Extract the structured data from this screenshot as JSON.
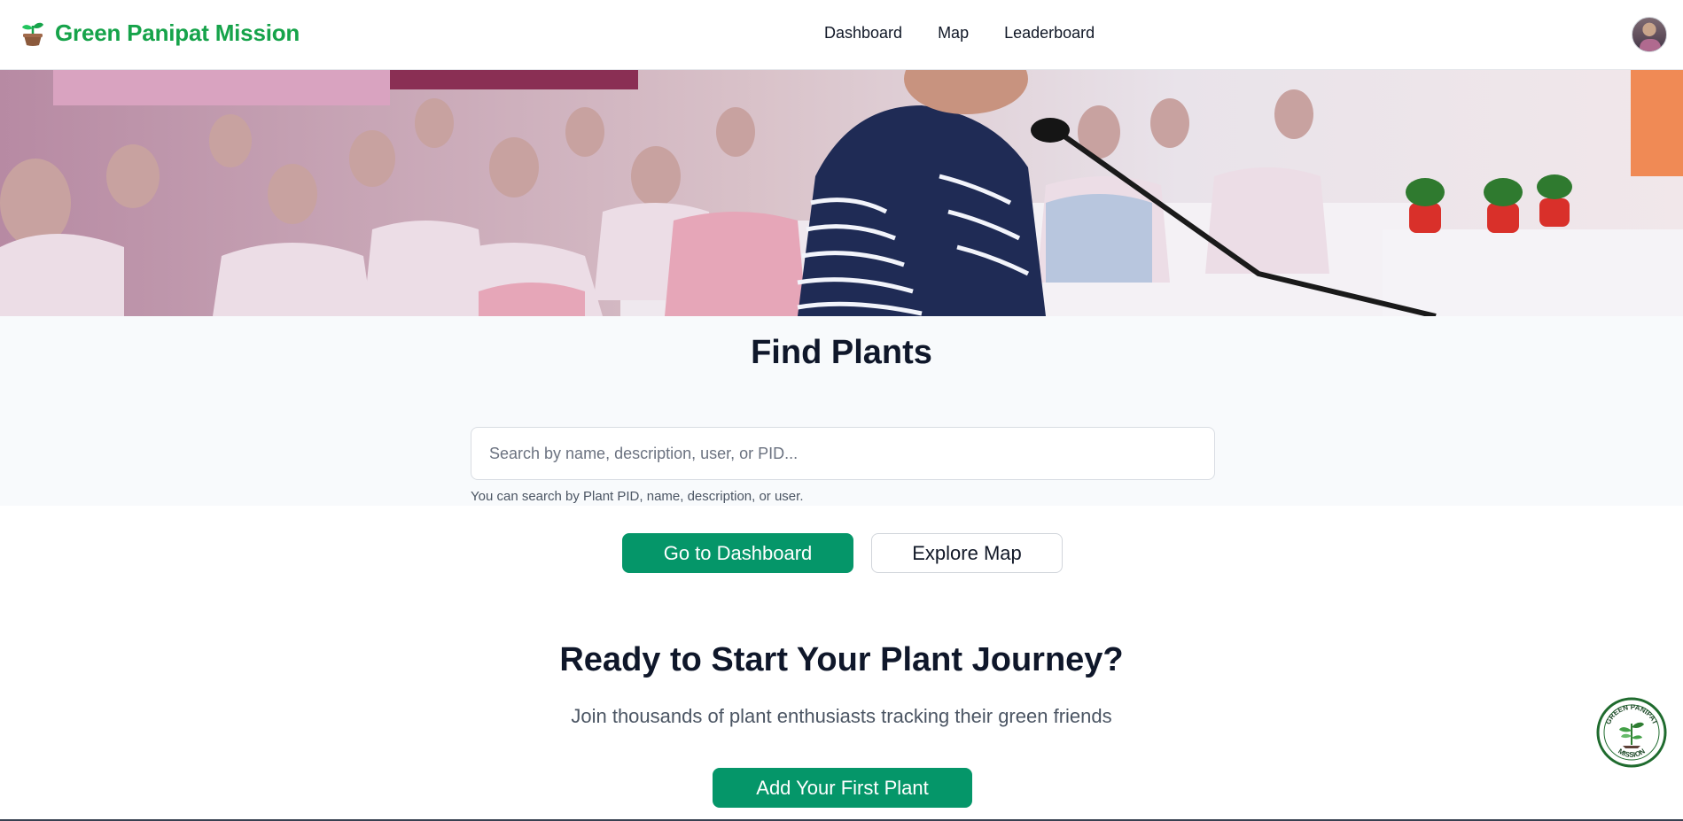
{
  "header": {
    "brand": {
      "name": "Green Panipat Mission",
      "icon": "sprout-icon"
    },
    "nav": [
      {
        "label": "Dashboard"
      },
      {
        "label": "Map"
      },
      {
        "label": "Leaderboard"
      }
    ],
    "avatar": {
      "icon": "user-avatar"
    }
  },
  "hero": {
    "image": "event-audience-photo"
  },
  "search": {
    "title": "Find Plants",
    "placeholder": "Search by name, description, user, or PID...",
    "value": "",
    "hint": "You can search by Plant PID, name, description, or user."
  },
  "actions": {
    "dashboard_label": "Go to Dashboard",
    "map_label": "Explore Map"
  },
  "cta": {
    "title": "Ready to Start Your Plant Journey?",
    "subtitle": "Join thousands of plant enthusiasts tracking their green friends",
    "button_label": "Add Your First Plant"
  },
  "badge": {
    "top_text": "GREEN PANIPAT",
    "bottom_text": "MISSION"
  },
  "colors": {
    "brand_green": "#16a34a",
    "button_green": "#059669",
    "heading": "#0f172a",
    "section_bg": "#f8fafc"
  }
}
